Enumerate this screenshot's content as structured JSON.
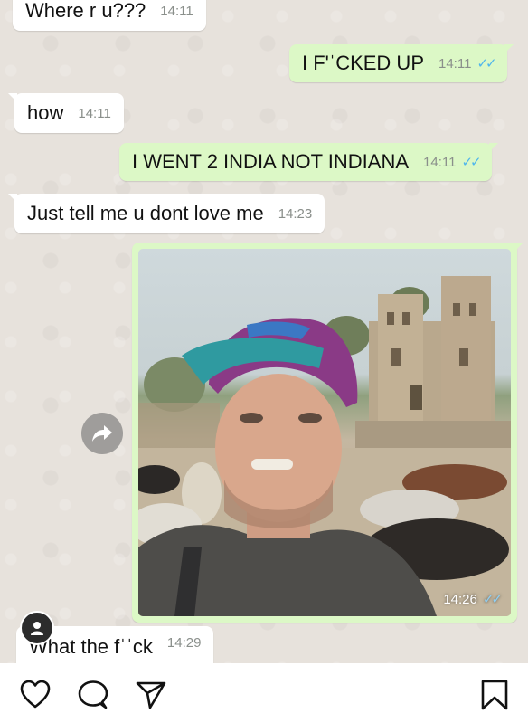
{
  "messages": [
    {
      "text": "Where r u???",
      "time": "14:11"
    },
    {
      "text": "I F'ˈCKED UP",
      "time": "14:11",
      "ticks": "✓✓"
    },
    {
      "text": "how",
      "time": "14:11"
    },
    {
      "text": "I WENT 2 INDIA NOT INDIANA",
      "time": "14:11",
      "ticks": "✓✓"
    },
    {
      "text": "Just tell me u dont love me",
      "time": "14:23"
    },
    {
      "text": "What the fˈˈck",
      "time": "14:29"
    }
  ],
  "photo": {
    "time": "14:26",
    "ticks": "✓✓"
  },
  "icons": {
    "forward": "forward-arrow-icon",
    "avatar": "person-avatar-icon",
    "like": "heart-icon",
    "comment": "comment-bubble-icon",
    "share": "paper-plane-icon",
    "save": "bookmark-icon"
  },
  "colors": {
    "incoming_bubble": "#ffffff",
    "outgoing_bubble": "#dcf8c6",
    "chat_background": "#e7e2dc",
    "read_ticks": "#4fb6ec"
  }
}
